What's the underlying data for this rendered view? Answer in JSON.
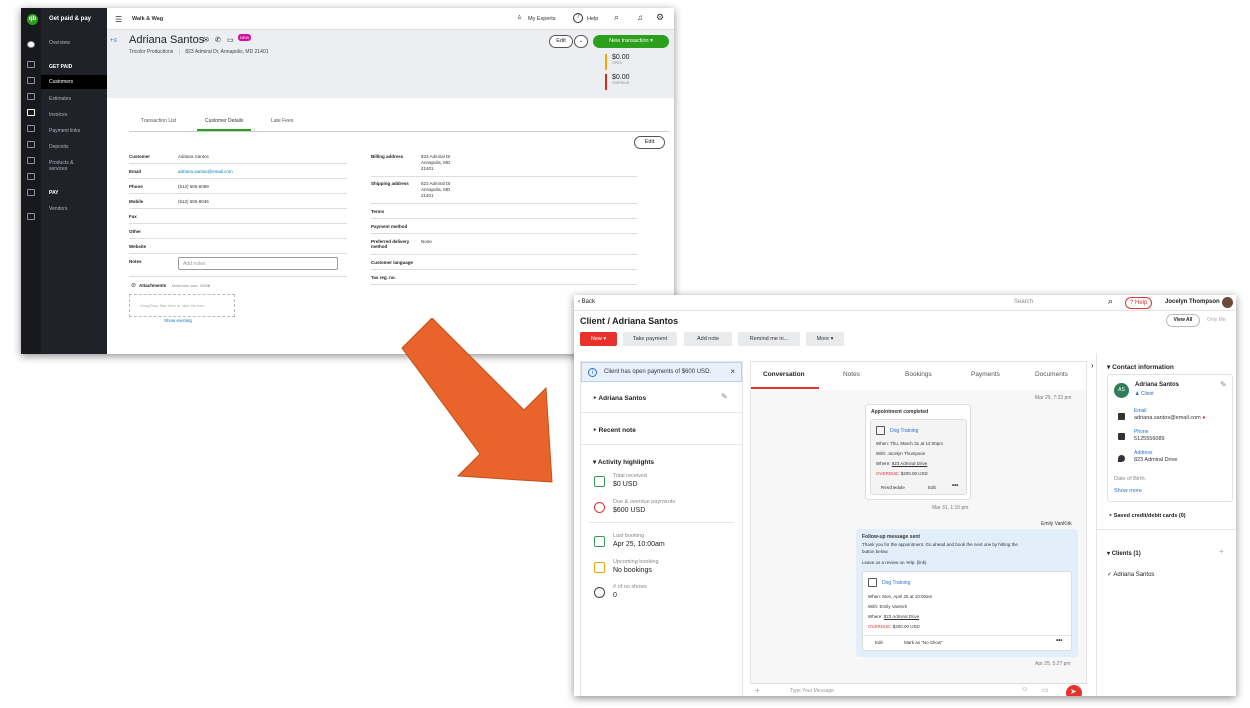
{
  "qb": {
    "brand": "Get paid & pay",
    "company": "Walk & Wag",
    "top_links": {
      "experts": "My Experts",
      "help": "Help"
    },
    "sidebar": {
      "overview": "Overview",
      "get_paid_header": "GET PAID",
      "items": [
        "Customers",
        "Estimates",
        "Invoices",
        "Payment links",
        "Deposits",
        "Products & services"
      ],
      "pay_header": "PAY",
      "vendors": "Vendors"
    },
    "customer": {
      "name": "Adriana Santos",
      "badge": "NEW",
      "company": "Tricolor Productions",
      "address": "823 Admiral Dr, Annapolis, MD 21401",
      "edit": "Edit",
      "new_transaction": "New transaction",
      "open_amount": "$0.00",
      "open_label": "OPEN",
      "overdue_amount": "$0.00",
      "overdue_label": "OVERDUE"
    },
    "tabs": [
      "Transaction List",
      "Customer Details",
      "Late Fees"
    ],
    "details_edit": "Edit",
    "left_fields": [
      {
        "label": "Customer",
        "value": "Adriana Santos"
      },
      {
        "label": "Email",
        "value": "adriana.santos@email.com"
      },
      {
        "label": "Phone",
        "value": "(512) 555-6089"
      },
      {
        "label": "Mobile",
        "value": "(512) 555-8046"
      },
      {
        "label": "Fax",
        "value": ""
      },
      {
        "label": "Other",
        "value": ""
      },
      {
        "label": "Website",
        "value": ""
      },
      {
        "label": "Notes",
        "value": ""
      }
    ],
    "notes_placeholder": "Add notes",
    "right_fields": [
      {
        "label": "Billing address",
        "value": "823 Admiral Dr\nAnnapolis, MD\n21401"
      },
      {
        "label": "Shipping address",
        "value": "823 Admiral Dr\nAnnapolis, MD\n21401"
      },
      {
        "label": "Terms",
        "value": ""
      },
      {
        "label": "Payment method",
        "value": ""
      },
      {
        "label": "Preferred delivery method",
        "value": "None"
      },
      {
        "label": "Customer language",
        "value": ""
      },
      {
        "label": "Tax reg. no.",
        "value": ""
      }
    ],
    "attachments": "Attachments",
    "max_size": "Maximum size: 20MB",
    "drop_text": "Drag/Drop files here or click the icon",
    "show_existing": "Show existing"
  },
  "crm": {
    "back": "Back",
    "search_placeholder": "Search",
    "help": "Help",
    "user": "Jocelyn Thompson",
    "title": "Client / Adriana Santos",
    "view_all": "View All",
    "only_me": "Only Me",
    "actions": [
      "New",
      "Take payment",
      "Add note",
      "Remind me in...",
      "More"
    ],
    "banner": "Client has open payments of $600 USD.",
    "client_name": "Adriana Santos",
    "recent_note": "Recent note",
    "activity_highlights": "Activity highlights",
    "highlights": [
      {
        "label": "Total received",
        "value": "$0 USD"
      },
      {
        "label": "Due & overdue payments",
        "value": "$600 USD"
      },
      {
        "label": "Last booking",
        "value": "Apr 25, 10:00am"
      },
      {
        "label": "Upcoming booking",
        "value": "No bookings"
      },
      {
        "label": "# of no shows",
        "value": "0"
      }
    ],
    "tabs": [
      "Conversation",
      "Notes",
      "Bookings",
      "Payments",
      "Documents"
    ],
    "ts1": "Mar 29, 7:33 pm",
    "appt": {
      "title": "Appointment completed",
      "service": "Dog Training",
      "when": "When:  Thu, March 31 at 12:00pm",
      "with": "With:  Jocelyn Thompson",
      "where_lbl": "Where: ",
      "where": "823 Admiral Drive",
      "overdue_lbl": "OVERDUE:",
      "overdue_amt": "$200.00 USD",
      "reschedule": "Reschedule",
      "edit": "Edit"
    },
    "ts2": "Mar 31, 1:16 pm",
    "sender": "Emily VanKirk",
    "followup": {
      "title": "Follow-up message sent",
      "body1": "Thank you for the appointment. Go ahead and book the next one by hitting the",
      "body2": "button below.",
      "review": "Leave us a review on Yelp: {link}",
      "service": "Dog Training",
      "when": "When:  Mon, April 25 at 10:00am",
      "with": "With:  Emily VanKirk",
      "where_lbl": "Where: ",
      "where": "823 Admiral Drive",
      "overdue_lbl": "OVERDUE:",
      "overdue_amt": "$200.00 USD",
      "edit": "Edit",
      "no_show": "Mark as \"No Show\""
    },
    "ts3": "Apr 25, 5:27 pm",
    "message_placeholder": "Type Your Message",
    "contact": {
      "header": "Contact information",
      "name": "Adriana Santos",
      "initials": "AS",
      "role": "Client",
      "email_lbl": "Email",
      "email": "adriana.santos@email.com",
      "phone_lbl": "Phone",
      "phone": "5125556089",
      "address_lbl": "Address",
      "address": "823 Admiral Drive",
      "dob": "Date of Birth:",
      "show_more": "Show more"
    },
    "saved_cards": "Saved credit/debit cards (0)",
    "clients_header": "Clients (1)",
    "client_item": "Adriana Santos"
  }
}
